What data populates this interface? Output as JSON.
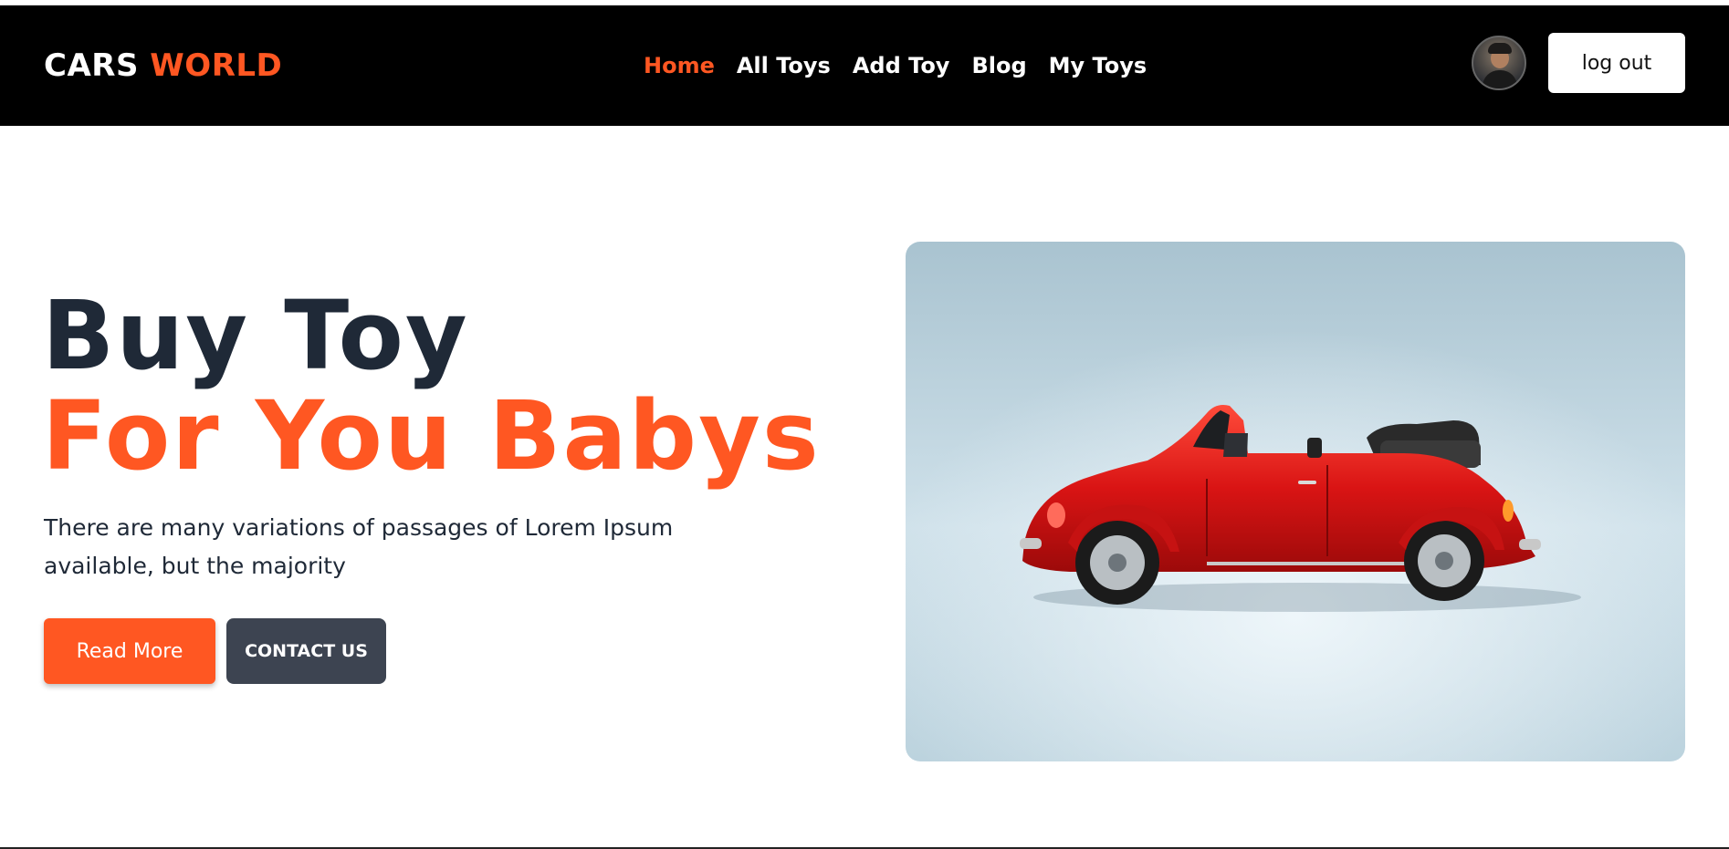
{
  "header": {
    "logo_part1": "CARS",
    "logo_part2": "WORLD",
    "nav": [
      {
        "label": "Home",
        "active": true
      },
      {
        "label": "All Toys",
        "active": false
      },
      {
        "label": "Add Toy",
        "active": false
      },
      {
        "label": "Blog",
        "active": false
      },
      {
        "label": "My Toys",
        "active": false
      }
    ],
    "avatar_icon": "user-avatar",
    "logout_label": "log out"
  },
  "hero": {
    "headline_line1": "Buy Toy",
    "headline_line2": "For You Babys",
    "description": "There are many variations of passages of Lorem Ipsum available, but the majority",
    "read_more_label": "Read More",
    "contact_label": "CONTACT US",
    "image_subject": "red toy convertible car"
  },
  "colors": {
    "accent": "#ff5722",
    "header_bg": "#000000",
    "heading_dark": "#1f2937",
    "contact_button_bg": "#3d4451"
  }
}
